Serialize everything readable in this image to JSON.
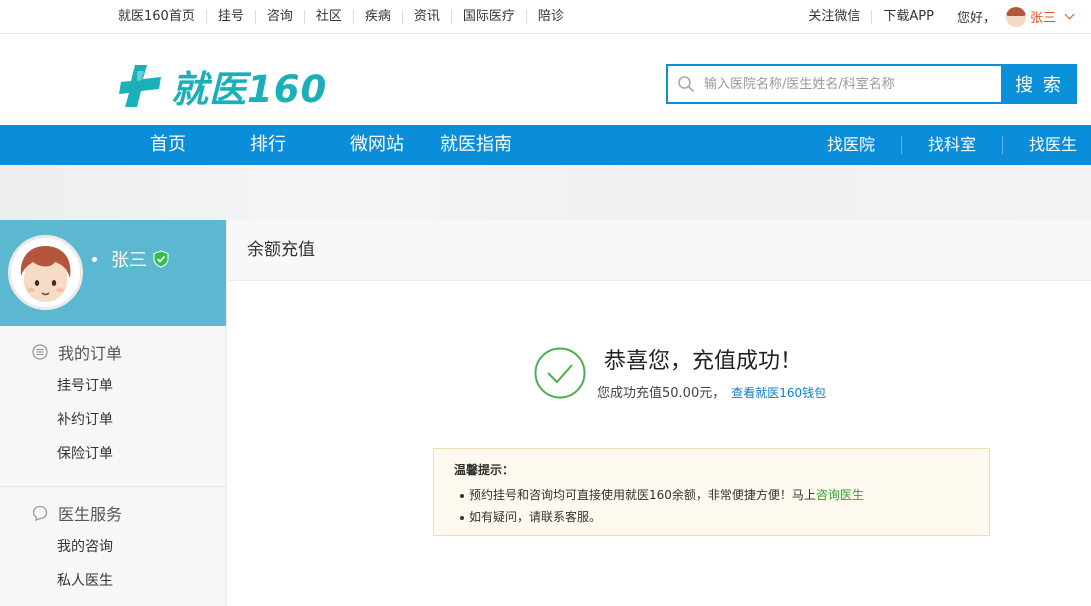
{
  "topbar": {
    "nav": [
      "就医160首页",
      "挂号",
      "咨询",
      "社区",
      "疾病",
      "资讯",
      "国际医疗",
      "陪诊"
    ],
    "follow_wechat": "关注微信",
    "download_app": "下载APP",
    "hello": "您好，",
    "username": "张三"
  },
  "header": {
    "logo_text": "就医160",
    "search_placeholder": "输入医院名称/医生姓名/科室名称",
    "search_button": "搜 索",
    "brand_color": "#1bb0b8"
  },
  "mainnav": {
    "left": [
      "首页",
      "排行",
      "微网站",
      "就医指南"
    ],
    "right": [
      "找医院",
      "找科室",
      "找医生"
    ],
    "bg_color": "#0b8ed9"
  },
  "sidebar": {
    "profile_name": "张三",
    "groups": [
      {
        "title": "我的订单",
        "items": [
          "挂号订单",
          "补约订单",
          "保险订单"
        ]
      },
      {
        "title": "医生服务",
        "items": [
          "我的咨询",
          "私人医生"
        ]
      }
    ]
  },
  "main": {
    "section_title": "余额充值",
    "success_title": "恭喜您，充值成功！",
    "success_text": "您成功充值50.00元，",
    "wallet_link": "查看就医160钱包",
    "success_color": "#4caf50",
    "tips": {
      "title": "温馨提示：",
      "line1": "预约挂号和咨询均可直接使用就医160余额，非常便捷方便！马上",
      "line1_link": "咨询医生",
      "line2": "如有疑问，请联系客服。"
    }
  }
}
